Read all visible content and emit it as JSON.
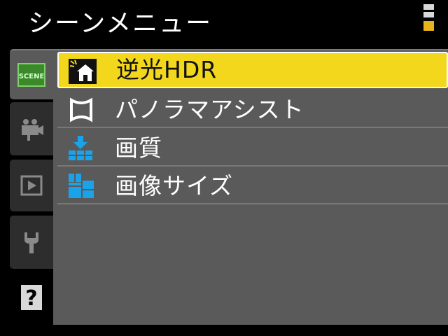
{
  "header": {
    "title": "シーンメニュー",
    "battery_icon": "battery-icon"
  },
  "tabs": [
    {
      "name": "scene",
      "label": "SCENE",
      "icon": "scene-tab-icon",
      "active": true
    },
    {
      "name": "movie",
      "icon": "movie-camera-icon",
      "active": false
    },
    {
      "name": "playback",
      "icon": "playback-icon",
      "active": false
    },
    {
      "name": "setup",
      "icon": "wrench-icon",
      "active": false
    },
    {
      "name": "help",
      "label": "?",
      "icon": "help-icon",
      "active": false
    }
  ],
  "menu": {
    "items": [
      {
        "label": "逆光HDR",
        "icon": "backlight-hdr-icon",
        "selected": true
      },
      {
        "label": "パノラマアシスト",
        "icon": "panorama-assist-icon",
        "selected": false
      },
      {
        "label": "画質",
        "icon": "image-quality-icon",
        "selected": false
      },
      {
        "label": "画像サイズ",
        "icon": "image-size-icon",
        "selected": false
      }
    ]
  },
  "colors": {
    "background": "#000000",
    "panel": "#5a5a5a",
    "highlight": "#f2d71c",
    "icon_blue": "#1aa3e8",
    "scene_green": "#3a8a2a",
    "battery_low": "#e8b41a"
  }
}
